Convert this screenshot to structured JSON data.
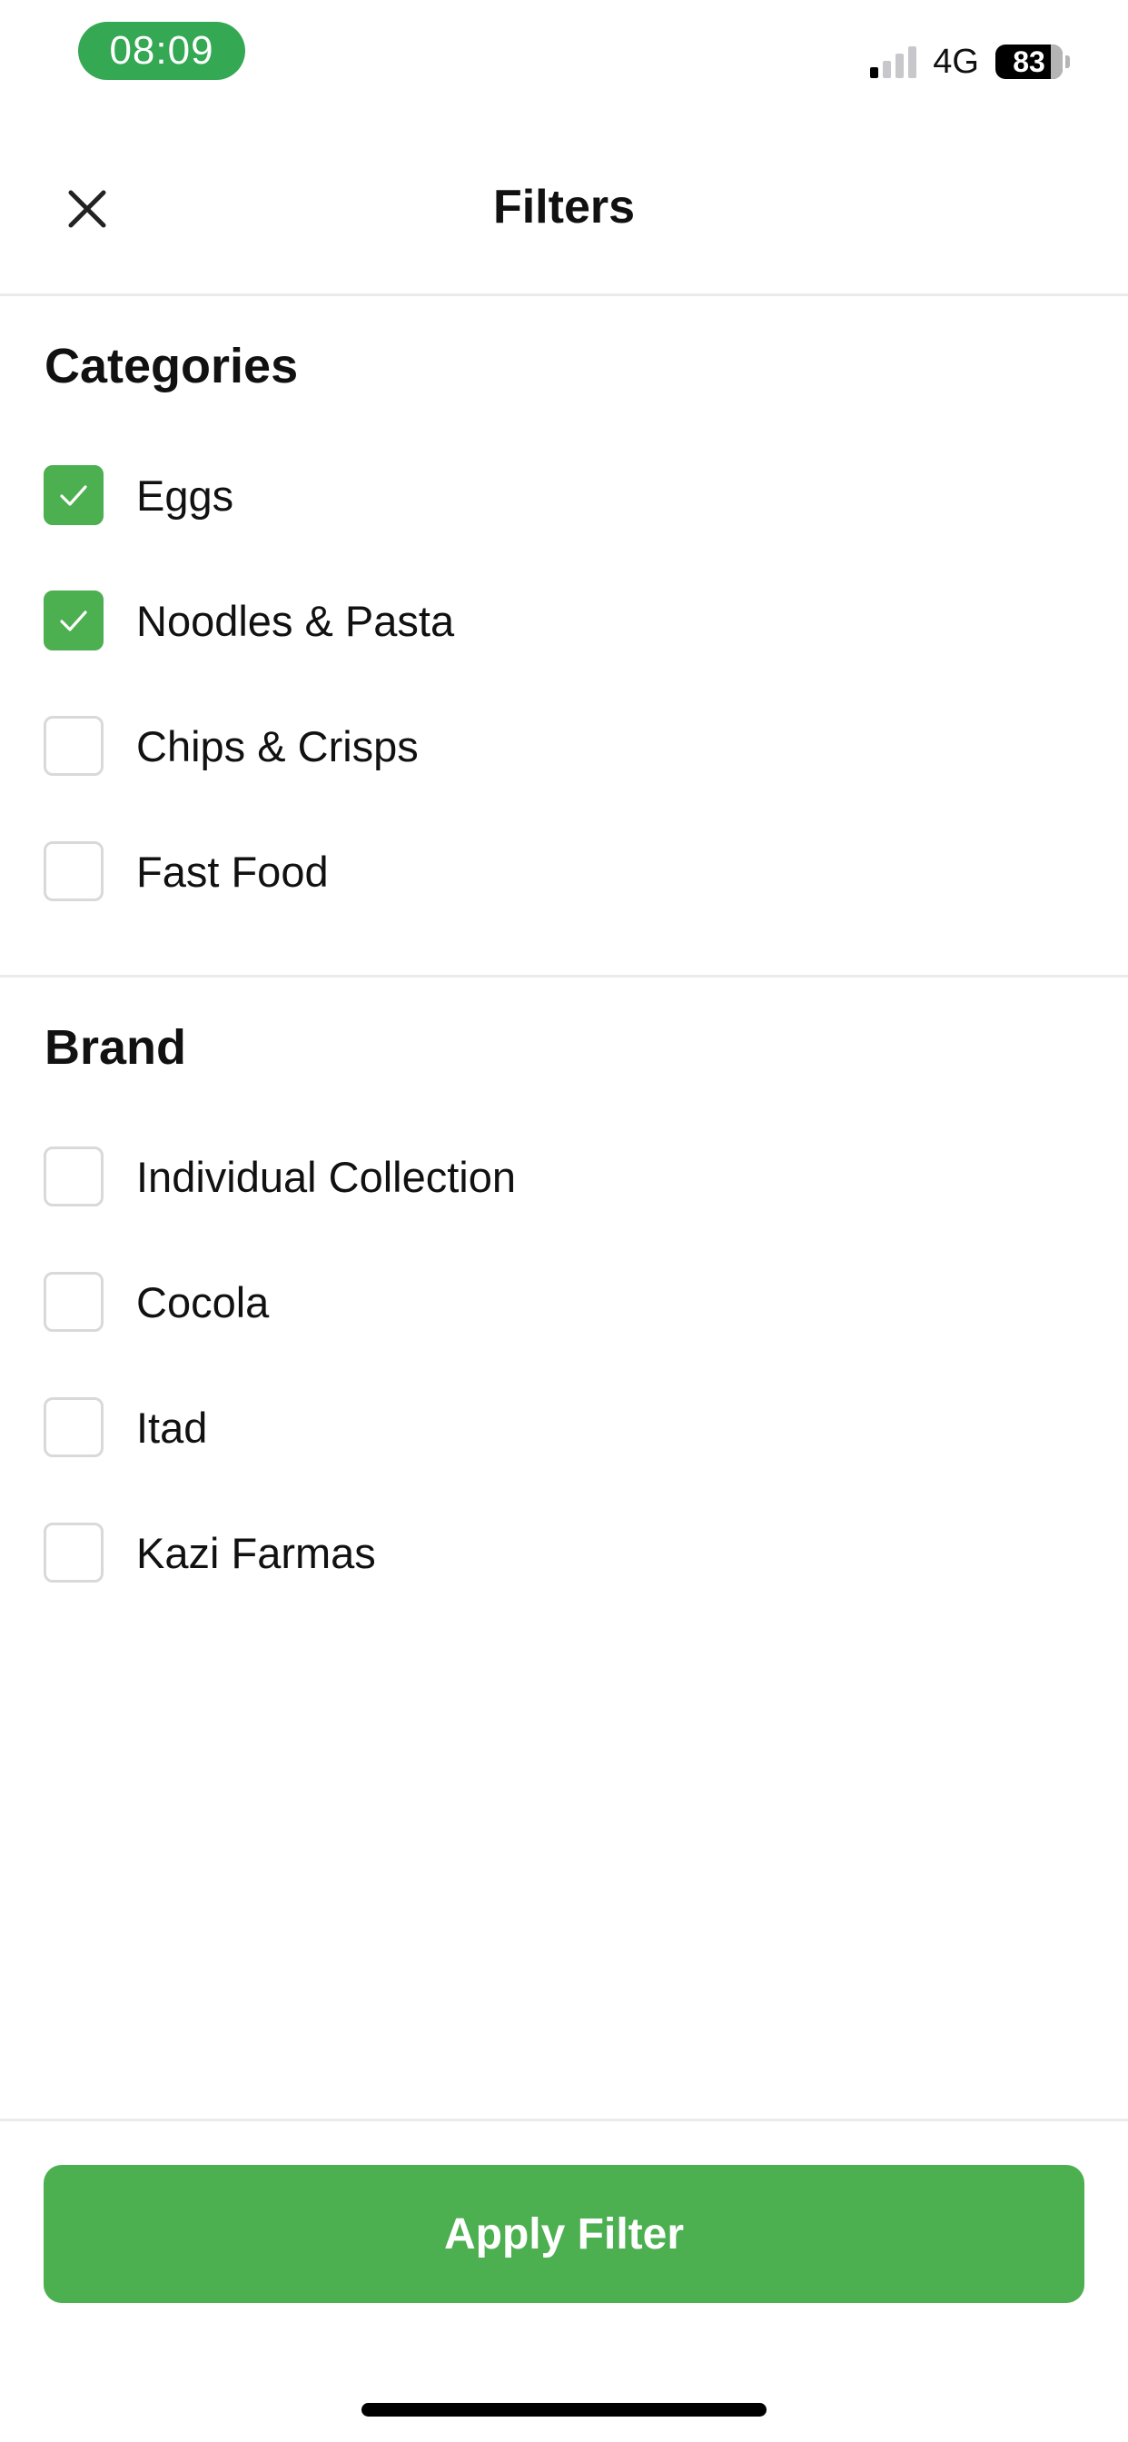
{
  "status_bar": {
    "time": "08:09",
    "network": "4G",
    "battery": "83",
    "signal_bars_active": 1,
    "signal_bars_total": 4
  },
  "header": {
    "title": "Filters",
    "close_icon": "close-icon"
  },
  "categories": {
    "title": "Categories",
    "options": [
      {
        "label": "Eggs",
        "checked": true
      },
      {
        "label": "Noodles & Pasta",
        "checked": true
      },
      {
        "label": "Chips & Crisps",
        "checked": false
      },
      {
        "label": "Fast Food",
        "checked": false
      }
    ]
  },
  "brand": {
    "title": "Brand",
    "options": [
      {
        "label": "Individual Collection",
        "checked": false
      },
      {
        "label": "Cocola",
        "checked": false
      },
      {
        "label": "Itad",
        "checked": false
      },
      {
        "label": "Kazi Farmas",
        "checked": false
      }
    ]
  },
  "footer": {
    "apply_label": "Apply Filter"
  },
  "colors": {
    "accent": "#4caf50",
    "status_pill": "#34a853",
    "checkbox_border": "#d9d9d9",
    "divider": "#ebebeb"
  }
}
